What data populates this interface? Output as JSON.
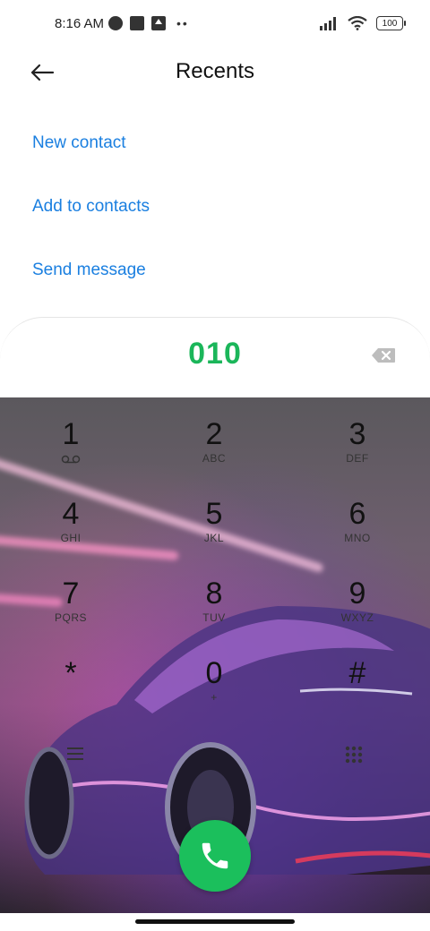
{
  "status_bar": {
    "time": "8:16 AM",
    "battery": "100"
  },
  "header": {
    "title": "Recents"
  },
  "actions": {
    "new_contact": "New contact",
    "add_to_contacts": "Add to contacts",
    "send_message": "Send message"
  },
  "dialer": {
    "number": "010",
    "accent_color": "#1bb65a",
    "link_color": "#1a7fe0",
    "keys": [
      {
        "digit": "1",
        "letters": ""
      },
      {
        "digit": "2",
        "letters": "ABC"
      },
      {
        "digit": "3",
        "letters": "DEF"
      },
      {
        "digit": "4",
        "letters": "GHI"
      },
      {
        "digit": "5",
        "letters": "JKL"
      },
      {
        "digit": "6",
        "letters": "MNO"
      },
      {
        "digit": "7",
        "letters": "PQRS"
      },
      {
        "digit": "8",
        "letters": "TUV"
      },
      {
        "digit": "9",
        "letters": "WXYZ"
      },
      {
        "digit": "*",
        "letters": ""
      },
      {
        "digit": "0",
        "letters": "+"
      },
      {
        "digit": "#",
        "letters": ""
      }
    ]
  },
  "icons": {
    "back": "back-arrow-icon",
    "backspace": "backspace-icon",
    "voicemail": "voicemail-icon",
    "menu": "menu-icon",
    "dialpad": "dialpad-grid-icon",
    "call": "phone-icon"
  }
}
